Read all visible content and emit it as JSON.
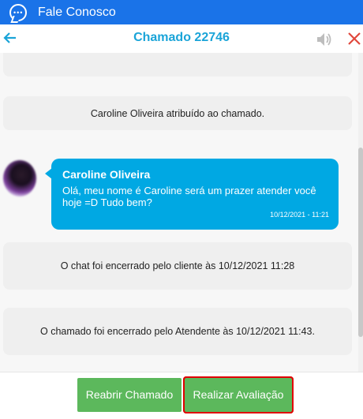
{
  "titlebar": {
    "app_title": "Fale Conosco",
    "icon": "chat-bubble-icon"
  },
  "header": {
    "title": "Chamado 22746",
    "back_icon": "arrow-left-icon",
    "sound_icon": "speaker-icon",
    "close_icon": "close-icon"
  },
  "messages": {
    "system_top_partial": "",
    "assigned": "Caroline Oliveira atribuído ao chamado.",
    "agent": {
      "sender": "Caroline Oliveira",
      "text": "Olá, meu nome é Caroline será um prazer atender você hoje =D Tudo bem?",
      "time": "10/12/2021 - 11:21"
    },
    "closed_by_client": "O chat foi encerrado pelo cliente às 10/12/2021 11:28",
    "closed_by_agent": "O chamado foi encerrado pelo Atendente às 10/12/2021 11:43."
  },
  "footer": {
    "reopen_label": "Reabrir Chamado",
    "rate_label": "Realizar Avaliação"
  },
  "colors": {
    "titlebar": "#1a73e8",
    "accent": "#1aa4d8",
    "bubble": "#00a8e3",
    "button": "#5cb85c",
    "highlight": "#e00000",
    "close": "#e0483c"
  }
}
